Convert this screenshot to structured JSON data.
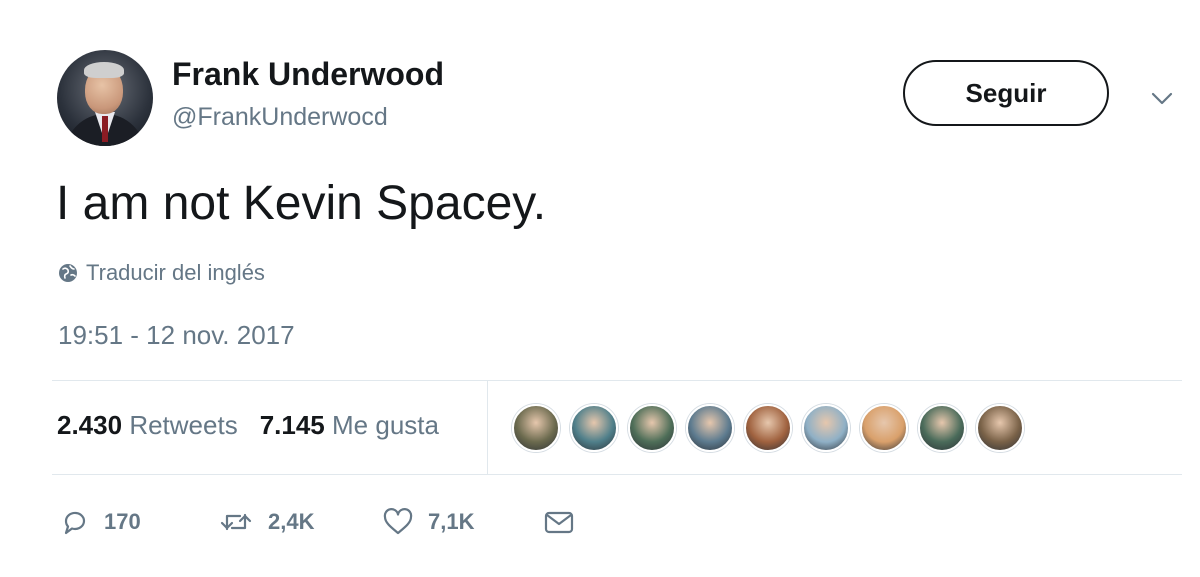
{
  "header": {
    "display_name": "Frank Underwood",
    "handle": "@FrankUnderwocd",
    "follow_label": "Seguir"
  },
  "tweet": {
    "text": "I am not Kevin Spacey.",
    "translate_label": "Traducir del inglés",
    "timestamp": "19:51 - 12 nov. 2017"
  },
  "stats": {
    "retweets_count": "2.430",
    "retweets_label": "Retweets",
    "likes_count": "7.145",
    "likes_label": "Me gusta"
  },
  "liker_avatar_colors": [
    "#6b6a4e",
    "#4f7f8a",
    "#4e6e58",
    "#5d7b8f",
    "#a0623f",
    "#8fb0c6",
    "#d9a06b",
    "#4a6b5a",
    "#7a6248"
  ],
  "actions": {
    "reply_count": "170",
    "retweet_count": "2,4K",
    "like_count": "7,1K"
  },
  "icons": [
    "chevron-down-icon",
    "globe-icon",
    "reply-icon",
    "retweet-icon",
    "heart-icon",
    "mail-icon"
  ],
  "colors": {
    "text": "#14171a",
    "secondary": "#657786",
    "divider": "#e1e8ed"
  }
}
